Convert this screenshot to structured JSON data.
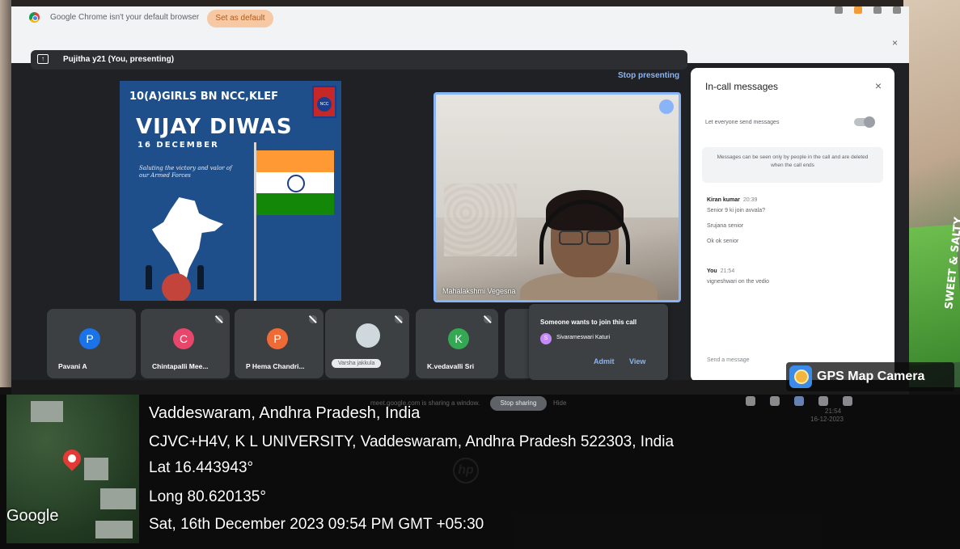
{
  "browser_infobar": {
    "message": "Google Chrome isn't your default browser",
    "set_default_label": "Set as default",
    "close_symbol": "×"
  },
  "meet": {
    "presenter_bar": "Pujitha y21 (You, presenting)",
    "present_icon": "↑",
    "stop_presenting": "Stop presenting",
    "presentation": {
      "unit": "10(A)GIRLS BN NCC,KLEF",
      "title": "VIJAY DIWAS",
      "date": "16 DECEMBER",
      "subtitle": "Saluting the victory and valor of our Armed Forces"
    },
    "main_video": {
      "name": "Mahalakshmi Vegesna"
    },
    "participants": [
      {
        "initial": "P",
        "name": "Pavani A",
        "color": "#1a73e8",
        "muted": false
      },
      {
        "initial": "C",
        "name": "Chintapalli Mee...",
        "color": "#e8476b",
        "muted": true
      },
      {
        "initial": "P",
        "name": "P Hema Chandri...",
        "color": "#f06a35",
        "muted": true
      },
      {
        "initial": "",
        "name": "Varsha jakkula",
        "color": "#e8eaed",
        "muted": true,
        "pill": true
      },
      {
        "initial": "K",
        "name": "K.vedavalli Sri",
        "color": "#34a853",
        "muted": true
      }
    ],
    "join_request": {
      "heading": "Someone wants to join this call",
      "user_initial": "S",
      "user": "Sivarameswari Katuri",
      "admit": "Admit",
      "view": "View"
    },
    "chat": {
      "title": "In-call messages",
      "close_symbol": "×",
      "toggle_label": "Let everyone send messages",
      "info": "Messages can be seen only by people in the call and are deleted when the call ends",
      "messages": [
        {
          "sender": "Kiran kumar",
          "time": "20:39",
          "lines": [
            "Senior 9 ki join avvala?",
            "Srujana senior",
            "Ok ok senior"
          ]
        },
        {
          "sender": "You",
          "time": "21:54",
          "lines": [
            "vigneshwari on the vedio"
          ]
        }
      ],
      "placeholder": "Send a message"
    },
    "share_bar": {
      "text": "meet.google.com is sharing a window.",
      "stop_sharing": "Stop sharing",
      "hide": "Hide"
    },
    "taskbar_clock": {
      "time": "21:54",
      "date": "16-12-2023"
    }
  },
  "gps_overlay": {
    "badge": "GPS Map Camera",
    "place": "Vaddeswaram, Andhra Pradesh, India",
    "address": "CJVC+H4V, K L UNIVERSITY, Vaddeswaram, Andhra Pradesh 522303, India",
    "lat": "Lat 16.443943°",
    "long": "Long 80.620135°",
    "datetime": "Sat, 16th December 2023 09:54 PM GMT +05:30",
    "map_label": "Google"
  },
  "device": {
    "logo": "hp",
    "package_text": "SWEET & SALTY"
  }
}
